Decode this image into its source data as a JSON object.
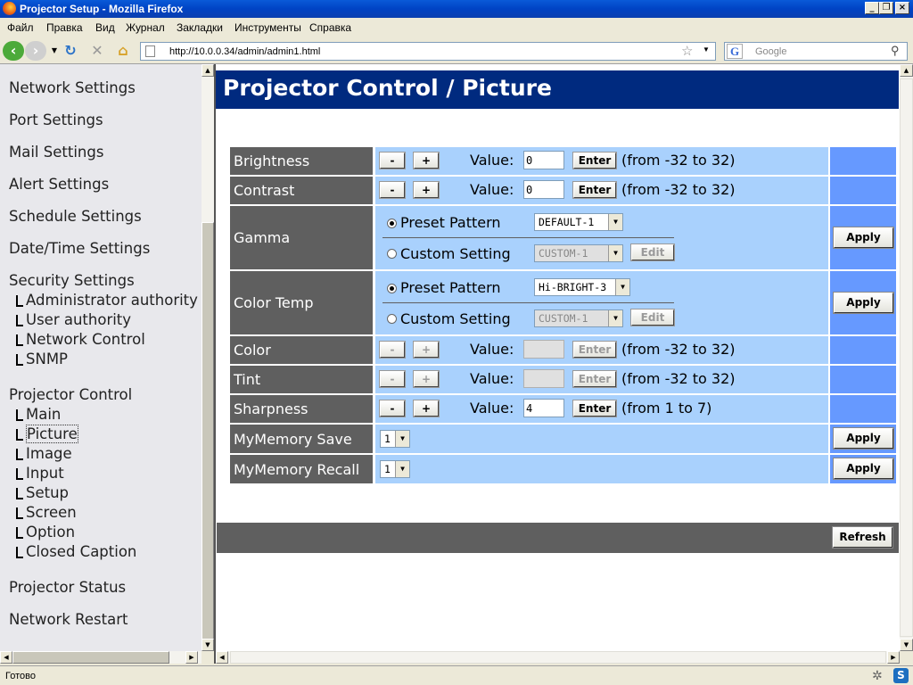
{
  "window": {
    "title": "Projector Setup - Mozilla Firefox"
  },
  "menu": [
    "Файл",
    "Правка",
    "Вид",
    "Журнал",
    "Закладки",
    "Инструменты",
    "Справка"
  ],
  "nav": {
    "url": "http://10.0.0.34/admin/admin1.html",
    "search_placeholder": "Google"
  },
  "sidebar": {
    "items": [
      "Network Settings",
      "Port Settings",
      "Mail Settings",
      "Alert Settings",
      "Schedule Settings",
      "Date/Time Settings"
    ],
    "security": {
      "label": "Security Settings",
      "subs": [
        "Administrator authority",
        "User authority",
        "Network Control",
        "SNMP"
      ]
    },
    "projector": {
      "label": "Projector Control",
      "subs": [
        "Main",
        "Picture",
        "Image",
        "Input",
        "Setup",
        "Screen",
        "Option",
        "Closed Caption"
      ]
    },
    "bottom": [
      "Projector Status",
      "Network Restart"
    ]
  },
  "page": {
    "title": "Projector Control / Picture"
  },
  "form": {
    "minus": "-",
    "plus": "+",
    "value_label": "Value:",
    "enter": "Enter",
    "apply": "Apply",
    "edit": "Edit",
    "preset": "Preset Pattern",
    "custom": "Custom Setting",
    "range_32": "(from -32 to 32)",
    "range_17": "(from 1 to 7)",
    "brightness": {
      "label": "Brightness",
      "value": "0"
    },
    "contrast": {
      "label": "Contrast",
      "value": "0"
    },
    "gamma": {
      "label": "Gamma",
      "preset_value": "DEFAULT-1",
      "custom_value": "CUSTOM-1"
    },
    "color_temp": {
      "label": "Color Temp",
      "preset_value": "Hi-BRIGHT-3",
      "custom_value": "CUSTOM-1"
    },
    "color": {
      "label": "Color",
      "value": ""
    },
    "tint": {
      "label": "Tint",
      "value": ""
    },
    "sharpness": {
      "label": "Sharpness",
      "value": "4"
    },
    "mymemory_save": {
      "label": "MyMemory Save",
      "value": "1"
    },
    "mymemory_recall": {
      "label": "MyMemory Recall",
      "value": "1"
    },
    "refresh": "Refresh"
  },
  "status": {
    "text": "Готово"
  },
  "colors": {
    "header": "#002a7f",
    "label_bg": "#5f5f5f",
    "row_bg": "#a9d1fd",
    "action_bg": "#6699ff"
  }
}
